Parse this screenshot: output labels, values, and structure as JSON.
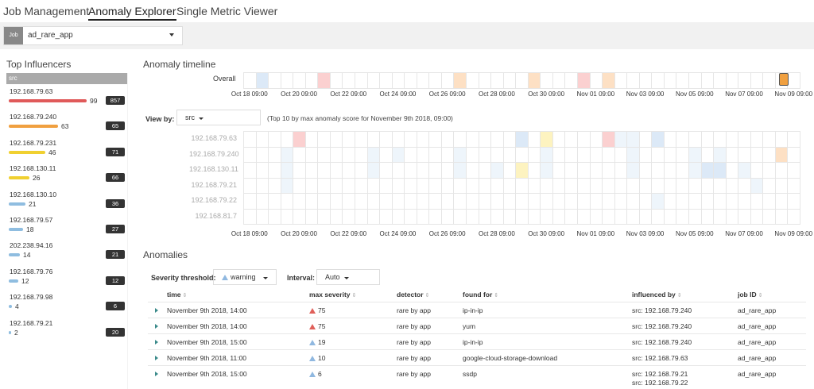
{
  "tabs": [
    {
      "label": "Job Management",
      "active": false
    },
    {
      "label": "Anomaly Explorer",
      "active": true
    },
    {
      "label": "Single Metric Viewer",
      "active": false
    }
  ],
  "job_selector": {
    "label": "Job",
    "value": "ad_rare_app"
  },
  "influencers": {
    "title": "Top Influencers",
    "field": "src",
    "items": [
      {
        "ip": "192.168.79.63",
        "score": "99",
        "count": "857",
        "color": "#e05a5a"
      },
      {
        "ip": "192.168.79.240",
        "score": "63",
        "count": "65",
        "color": "#f0a040"
      },
      {
        "ip": "192.168.79.231",
        "score": "46",
        "count": "71",
        "color": "#f0d030"
      },
      {
        "ip": "192.168.130.11",
        "score": "26",
        "count": "66",
        "color": "#f0d030"
      },
      {
        "ip": "192.168.130.10",
        "score": "21",
        "count": "36",
        "color": "#8fbde0"
      },
      {
        "ip": "192.168.79.57",
        "score": "18",
        "count": "27",
        "color": "#8fbde0"
      },
      {
        "ip": "202.238.94.16",
        "score": "14",
        "count": "21",
        "color": "#8fbde0"
      },
      {
        "ip": "192.168.79.76",
        "score": "12",
        "count": "12",
        "color": "#8fbde0"
      },
      {
        "ip": "192.168.79.98",
        "score": "4",
        "count": "6",
        "color": "#8fbde0"
      },
      {
        "ip": "192.168.79.21",
        "score": "2",
        "count": "20",
        "color": "#8fbde0"
      }
    ]
  },
  "timeline": {
    "title": "Anomaly timeline",
    "overall_label": "Overall",
    "ticks": [
      "Oct 18 09:00",
      "Oct 20 09:00",
      "Oct 22 09:00",
      "Oct 24 09:00",
      "Oct 26 09:00",
      "Oct 28 09:00",
      "Oct 30 09:00",
      "Nov 01 09:00",
      "Nov 03 09:00",
      "Nov 05 09:00",
      "Nov 07 09:00",
      "Nov 09 09:00"
    ],
    "overall_cells": [
      "n",
      "l",
      "n",
      "n",
      "n",
      "n",
      "r",
      "n",
      "n",
      "n",
      "n",
      "n",
      "n",
      "n",
      "n",
      "n",
      "n",
      "n",
      "n",
      "n",
      "n",
      "n",
      "n",
      "n",
      "n",
      "n",
      "n",
      "n",
      "n",
      "n",
      "n",
      "n",
      "n",
      "n",
      "n",
      "n",
      "n",
      "n",
      "n",
      "n",
      "n",
      "n",
      "n",
      "n",
      "n",
      "n",
      "n",
      "n",
      "n",
      "n",
      "n",
      "n",
      "n",
      "n",
      "n",
      "n",
      "n",
      "n",
      "n",
      "n",
      "n",
      "n",
      "n",
      "n",
      "n",
      "n",
      "n",
      "n",
      "n",
      "n",
      "n",
      "n",
      "n",
      "n",
      "n",
      "n",
      "n",
      "n",
      "n",
      "n",
      "n",
      "n",
      "n",
      "n",
      "n",
      "n",
      "n",
      "n",
      "n",
      "n",
      "n",
      "n",
      "n",
      "n",
      "n",
      "n",
      "n",
      "n",
      "n",
      "n",
      "n",
      "n",
      "n",
      "n",
      "n",
      "n",
      "n",
      "n",
      "n",
      "n",
      "n",
      "n",
      "n",
      "n",
      "n",
      "n",
      "n",
      "n",
      "n",
      "n"
    ],
    "view_by_label": "View by:",
    "view_by_value": "src",
    "note": "(Top 10 by max anomaly score for November 9th 2018, 09:00)",
    "swim_rows": [
      "192.168.79.63",
      "192.168.79.240",
      "192.168.130.11",
      "192.168.79.21",
      "192.168.79.22",
      "192.168.81.7"
    ],
    "colors": {
      "red": "#fbd0d0",
      "orange": "#fde0c4",
      "yellow": "#fdf3c0",
      "blue": "#dce9f7",
      "lightblue": "#eef5fb",
      "selected": "#f0a040"
    }
  },
  "anomalies": {
    "title": "Anomalies",
    "severity_label": "Severity threshold:",
    "severity_value": "warning",
    "interval_label": "Interval:",
    "interval_value": "Auto",
    "columns": [
      "time",
      "max severity",
      "detector",
      "found for",
      "influenced by",
      "job ID"
    ],
    "rows": [
      {
        "time": "November 9th 2018, 14:00",
        "severity": "75",
        "sev_color": "red",
        "detector": "rare by app",
        "found_for": "ip-in-ip",
        "influenced_by": "src: 192.168.79.240",
        "influenced_by_2": "",
        "job_id": "ad_rare_app"
      },
      {
        "time": "November 9th 2018, 14:00",
        "severity": "75",
        "sev_color": "red",
        "detector": "rare by app",
        "found_for": "yum",
        "influenced_by": "src: 192.168.79.240",
        "influenced_by_2": "",
        "job_id": "ad_rare_app"
      },
      {
        "time": "November 9th 2018, 15:00",
        "severity": "19",
        "sev_color": "blue",
        "detector": "rare by app",
        "found_for": "ip-in-ip",
        "influenced_by": "src: 192.168.79.240",
        "influenced_by_2": "",
        "job_id": "ad_rare_app"
      },
      {
        "time": "November 9th 2018, 11:00",
        "severity": "10",
        "sev_color": "blue",
        "detector": "rare by app",
        "found_for": "google-cloud-storage-download",
        "influenced_by": "src: 192.168.79.63",
        "influenced_by_2": "",
        "job_id": "ad_rare_app"
      },
      {
        "time": "November 9th 2018, 15:00",
        "severity": "6",
        "sev_color": "blue",
        "detector": "rare by app",
        "found_for": "ssdp",
        "influenced_by": "src: 192.168.79.21",
        "influenced_by_2": "src: 192.168.79.22",
        "job_id": "ad_rare_app"
      }
    ]
  }
}
